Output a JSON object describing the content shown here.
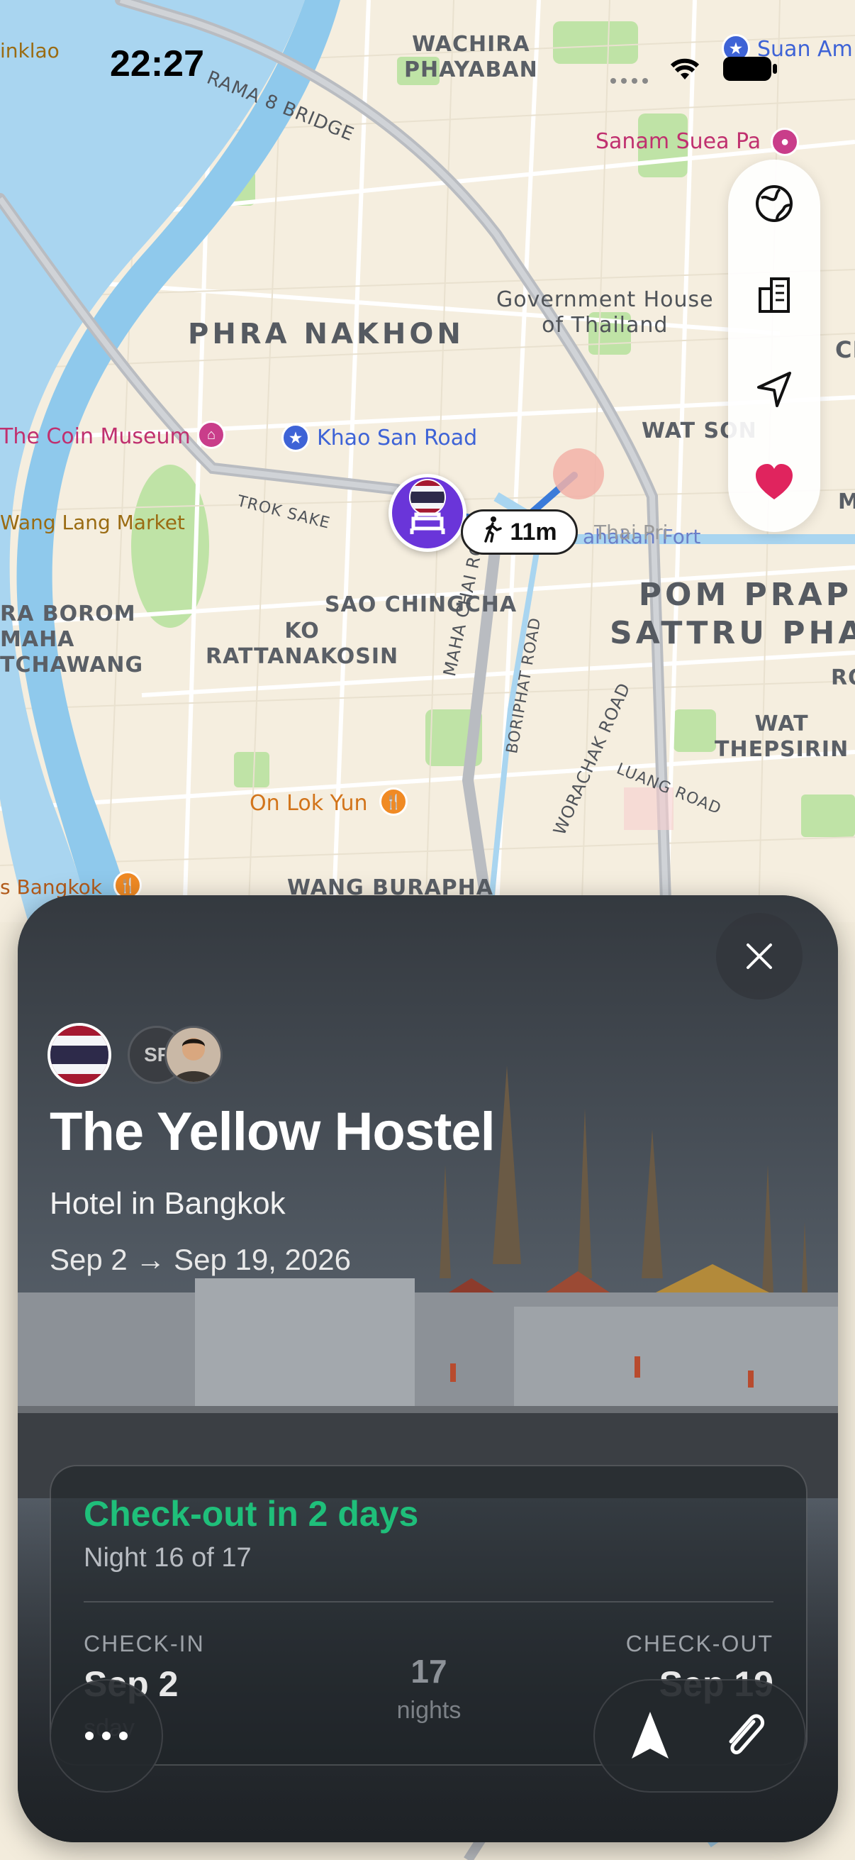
{
  "status_bar": {
    "time": "22:27"
  },
  "map": {
    "districts": {
      "wachira": "WACHIRA\nPHAYABAN",
      "phra_nakhon": "PHRA NAKHON",
      "wat_son": "WAT SON",
      "pom_prap": "POM PRAP\nSATTRU PHAI",
      "sao_chingcha": "SAO CHINGCHA",
      "ko_rattanakosin": "KO\nRATTANAKOSIN",
      "ra_borom": "RA BOROM\nMAHA\nTCHAWANG",
      "wat_thepsirin": "WAT\nTHEPSIRIN",
      "wang_burapha": "WANG BURAPHA",
      "ron": "RON",
      "ci": "CI",
      "m": "M"
    },
    "roads": {
      "rama8": "RAMA 8 BRIDGE",
      "trok_sake": "TROK SAKE",
      "maha_chai": "MAHA CHAI ROAD",
      "boriphat": "BORIPHAT ROAD",
      "worachak": "WORACHAK ROAD",
      "luang": "LUANG ROAD"
    },
    "pois": {
      "inklao": "inklao",
      "suan_am": "Suan Am",
      "sanam_suea": "Sanam Suea Pa",
      "government_house": "Government House\nof Thailand",
      "coin_museum": "The Coin Museum",
      "khao_san": "Khao San Road",
      "wang_lang": "Wang Lang Market",
      "mahakan_fort": "ahakan Fort",
      "thai_pri": "Thai Pri",
      "on_lok_yun": "On Lok Yun",
      "bangkok": "s Bangkok"
    }
  },
  "walk_badge": {
    "label": "11m",
    "icon": "walking-person-icon"
  },
  "map_controls": [
    "globe-icon",
    "buildings-icon",
    "location-arrow-icon",
    "heart-icon"
  ],
  "card": {
    "title": "The Yellow Hostel",
    "subtitle": "Hotel in Bangkok",
    "dates": "Sep 2 → Sep 19, 2026",
    "avatar_initials": "SF",
    "status": {
      "headline": "Check-out in 2 days",
      "progress": "Night 16 of 17",
      "check_in_caption": "CHECK-IN",
      "check_in_date": "Sep 2",
      "check_in_day": "sday",
      "nights_count": "17",
      "nights_label": "nights",
      "check_out_caption": "CHECK-OUT",
      "check_out_date": "Sep 19"
    }
  },
  "colors": {
    "accent_green": "#1fbf7a",
    "marker_purple": "#6a35d9",
    "heart_red": "#e0245e"
  }
}
